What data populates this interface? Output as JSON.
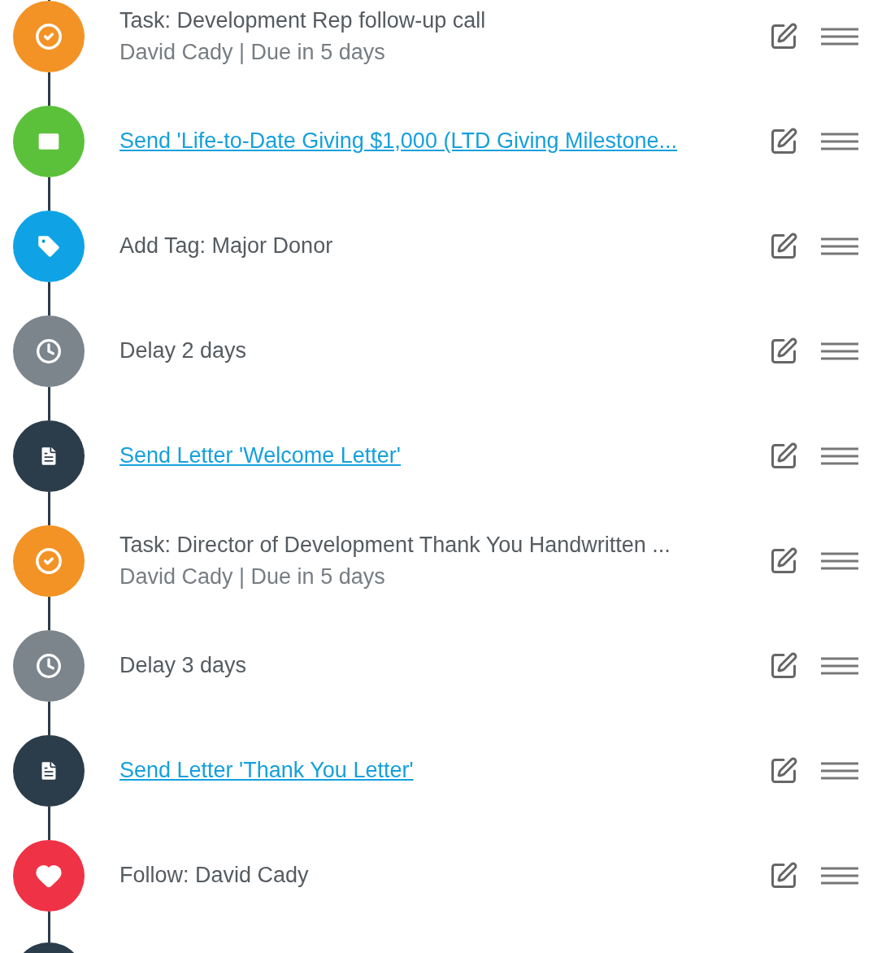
{
  "steps": [
    {
      "kind": "task",
      "color": "#f39325",
      "title": "Task: Development Rep follow-up call",
      "link": false,
      "subtitle": "David Cady | Due in 5 days"
    },
    {
      "kind": "email",
      "color": "#5cc13a",
      "title": "Send 'Life-to-Date Giving $1,000 (LTD Giving Milestone...",
      "link": true
    },
    {
      "kind": "tag",
      "color": "#0fa3e6",
      "title": "Add Tag: Major Donor",
      "link": false
    },
    {
      "kind": "delay",
      "color": "#7c858c",
      "title": "Delay 2 days",
      "link": false
    },
    {
      "kind": "letter",
      "color": "#2b3c4a",
      "title": "Send Letter 'Welcome Letter'",
      "link": true
    },
    {
      "kind": "task",
      "color": "#f39325",
      "title": "Task: Director of Development Thank You Handwritten ...",
      "link": false,
      "subtitle": "David Cady | Due in 5 days"
    },
    {
      "kind": "delay",
      "color": "#7c858c",
      "title": "Delay 3 days",
      "link": false
    },
    {
      "kind": "letter",
      "color": "#2b3c4a",
      "title": "Send Letter 'Thank You Letter'",
      "link": true
    },
    {
      "kind": "follow",
      "color": "#ef3245",
      "title": "Follow: David Cady",
      "link": false
    }
  ],
  "cut_off_step": {
    "color": "#2b3c4a"
  }
}
